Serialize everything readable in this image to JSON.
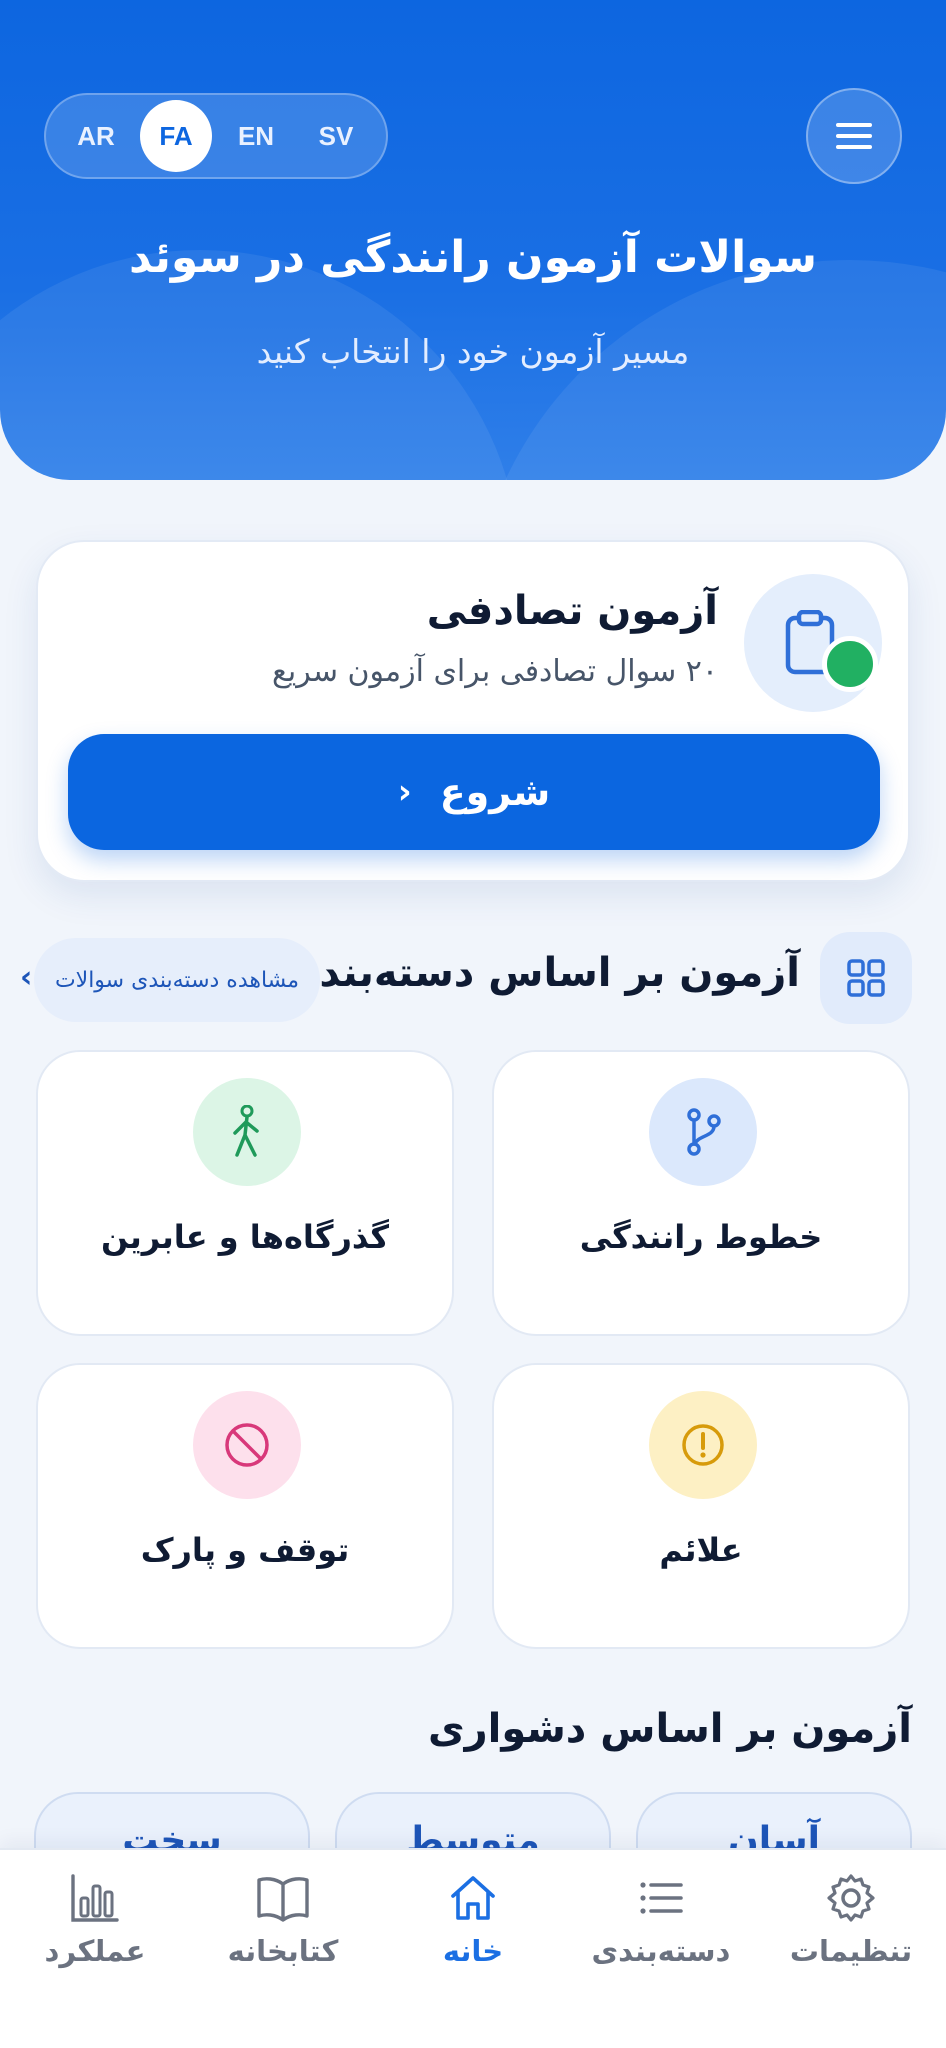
{
  "header": {
    "title": "سوالات آزمون رانندگی در سوئد",
    "subtitle": "مسیر آزمون خود را انتخاب کنید",
    "languages": [
      "AR",
      "FA",
      "EN",
      "SV"
    ],
    "active_language": "FA"
  },
  "random_quiz": {
    "title": "آزمون تصادفی",
    "subtitle": "۲۰ سوال تصادفی برای آزمون سریع",
    "start_label": "شروع"
  },
  "categories": {
    "title": "آزمون بر اساس دسته‌بندی",
    "see_all": "مشاهده دسته‌بندی سوالات",
    "items": [
      {
        "label": "خطوط رانندگی",
        "icon": "road-fork-icon",
        "color": "#2f6fd8",
        "bg": "#dbe8fc"
      },
      {
        "label": "گذرگاه‌ها و عابرین",
        "icon": "pedestrian-icon",
        "color": "#1f9a5a",
        "bg": "#dcf5e6"
      },
      {
        "label": "علائم",
        "icon": "warning-icon",
        "color": "#d79b0b",
        "bg": "#fdf0c4"
      },
      {
        "label": "توقف و پارک",
        "icon": "no-entry-icon",
        "color": "#d8387a",
        "bg": "#fde0ec"
      }
    ]
  },
  "difficulty": {
    "title": "آزمون بر اساس دشواری",
    "items": [
      "آسان",
      "متوسط",
      "سخت"
    ]
  },
  "nav": {
    "items": [
      {
        "label": "تنظیمات",
        "icon": "gear-icon"
      },
      {
        "label": "دسته‌بندی",
        "icon": "list-icon"
      },
      {
        "label": "خانه",
        "icon": "home-icon"
      },
      {
        "label": "کتابخانه",
        "icon": "book-icon"
      },
      {
        "label": "عملکرد",
        "icon": "bar-chart-icon"
      }
    ],
    "active": "خانه"
  },
  "colors": {
    "primary": "#0b66e0",
    "success": "#21b062"
  }
}
